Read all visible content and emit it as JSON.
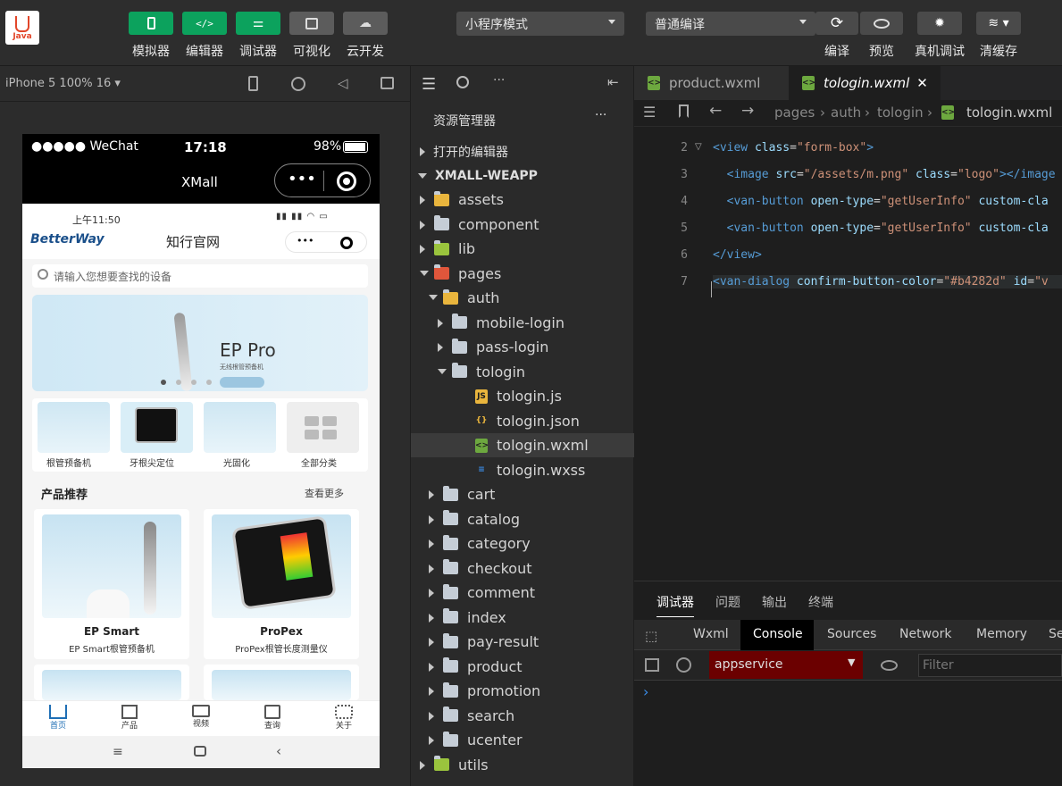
{
  "toolbar": {
    "logo_text": "Java",
    "buttons": [
      {
        "label": "模拟器",
        "icon": "phone-icon"
      },
      {
        "label": "编辑器",
        "icon": "code-icon"
      },
      {
        "label": "调试器",
        "icon": "sliders-icon"
      },
      {
        "label": "可视化",
        "icon": "layout-icon"
      },
      {
        "label": "云开发",
        "icon": "cloud-icon"
      }
    ],
    "mode_select": "小程序模式",
    "compile_select": "普通编译",
    "right_buttons": [
      {
        "label": "编译",
        "icon": "refresh-icon"
      },
      {
        "label": "预览",
        "icon": "eye-icon"
      },
      {
        "label": "真机调试",
        "icon": "bug-icon"
      },
      {
        "label": "清缓存",
        "icon": "layers-icon"
      }
    ]
  },
  "simulator": {
    "device_label": "iPhone 5 100% 16 ▾",
    "status": {
      "carrier": "●●●●● WeChat",
      "time": "17:18",
      "battery": "98%"
    },
    "nav_title": "XMall",
    "inner_status_time": "上午11:50",
    "brand_logo": "BetterWay",
    "site_title": "知行官网",
    "search_placeholder": "请输入您想要查找的设备",
    "banner_title": "EP Pro",
    "banner_sub": "无线根管预备机",
    "categories": [
      "根管预备机",
      "牙根尖定位",
      "光固化",
      "全部分类"
    ],
    "section_title": "产品推荐",
    "section_more": "查看更多",
    "products": [
      {
        "name": "EP Smart",
        "desc": "EP Smart根管预备机"
      },
      {
        "name": "ProPex",
        "desc": "ProPex根管长度测量仪"
      }
    ],
    "tabbar": [
      "首页",
      "产品",
      "视频",
      "查询",
      "关于"
    ]
  },
  "explorer": {
    "title": "资源管理器",
    "open_editors": "打开的编辑器",
    "project": "XMALL-WEAPP",
    "tree": [
      {
        "label": "assets",
        "depth": 1,
        "state": "collapsed",
        "type": "folder-special"
      },
      {
        "label": "component",
        "depth": 1,
        "state": "collapsed",
        "type": "folder"
      },
      {
        "label": "lib",
        "depth": 1,
        "state": "collapsed",
        "type": "folder-lib"
      },
      {
        "label": "pages",
        "depth": 1,
        "state": "expanded",
        "type": "folder-pages"
      },
      {
        "label": "auth",
        "depth": 2,
        "state": "expanded",
        "type": "folder-auth"
      },
      {
        "label": "mobile-login",
        "depth": 3,
        "state": "collapsed",
        "type": "folder"
      },
      {
        "label": "pass-login",
        "depth": 3,
        "state": "collapsed",
        "type": "folder"
      },
      {
        "label": "tologin",
        "depth": 3,
        "state": "expanded",
        "type": "folder-open"
      },
      {
        "label": "tologin.js",
        "depth": 4,
        "state": "file",
        "type": "js"
      },
      {
        "label": "tologin.json",
        "depth": 4,
        "state": "file",
        "type": "json"
      },
      {
        "label": "tologin.wxml",
        "depth": 4,
        "state": "file",
        "type": "wxml",
        "selected": true
      },
      {
        "label": "tologin.wxss",
        "depth": 4,
        "state": "file",
        "type": "wxss"
      },
      {
        "label": "cart",
        "depth": 2,
        "state": "collapsed",
        "type": "folder"
      },
      {
        "label": "catalog",
        "depth": 2,
        "state": "collapsed",
        "type": "folder"
      },
      {
        "label": "category",
        "depth": 2,
        "state": "collapsed",
        "type": "folder"
      },
      {
        "label": "checkout",
        "depth": 2,
        "state": "collapsed",
        "type": "folder"
      },
      {
        "label": "comment",
        "depth": 2,
        "state": "collapsed",
        "type": "folder"
      },
      {
        "label": "index",
        "depth": 2,
        "state": "collapsed",
        "type": "folder"
      },
      {
        "label": "pay-result",
        "depth": 2,
        "state": "collapsed",
        "type": "folder"
      },
      {
        "label": "product",
        "depth": 2,
        "state": "collapsed",
        "type": "folder"
      },
      {
        "label": "promotion",
        "depth": 2,
        "state": "collapsed",
        "type": "folder"
      },
      {
        "label": "search",
        "depth": 2,
        "state": "collapsed",
        "type": "folder"
      },
      {
        "label": "ucenter",
        "depth": 2,
        "state": "collapsed",
        "type": "folder"
      },
      {
        "label": "utils",
        "depth": 1,
        "state": "collapsed",
        "type": "folder-lib"
      }
    ]
  },
  "editor": {
    "tabs": [
      {
        "label": "product.wxml",
        "active": false
      },
      {
        "label": "tologin.wxml",
        "active": true
      }
    ],
    "breadcrumb": [
      "pages",
      "auth",
      "tologin",
      "tologin.wxml"
    ],
    "lines": [
      {
        "n": "2",
        "html": "<span class='tag'>&lt;view</span> <span class='attr'>class</span><span class='pun'>=</span><span class='str'>\"form-box\"</span><span class='tag'>&gt;</span>"
      },
      {
        "n": "3",
        "html": "  <span class='tag'>&lt;image</span> <span class='attr'>src</span><span class='pun'>=</span><span class='str'>\"/assets/m.png\"</span> <span class='attr'>class</span><span class='pun'>=</span><span class='str'>\"logo\"</span><span class='tag'>&gt;&lt;/image</span>"
      },
      {
        "n": "4",
        "html": "  <span class='tag'>&lt;van-button</span> <span class='attr'>open-type</span><span class='pun'>=</span><span class='str'>\"getUserInfo\"</span> <span class='attr'>custom-cla</span>"
      },
      {
        "n": "5",
        "html": "  <span class='tag'>&lt;van-button</span> <span class='attr'>open-type</span><span class='pun'>=</span><span class='str'>\"getUserInfo\"</span> <span class='attr'>custom-cla</span>"
      },
      {
        "n": "6",
        "html": "<span class='tag'>&lt;/view&gt;</span>"
      },
      {
        "n": "7",
        "html": "<span class='tag'>&lt;van-dialog</span> <span class='attr'>confirm-button-color</span><span class='pun'>=</span><span class='str'>\"#b4282d\"</span> <span class='attr'>id</span><span class='pun'>=</span><span class='str'>\"v</span>"
      }
    ]
  },
  "debugger": {
    "panel_tabs": [
      "调试器",
      "问题",
      "输出",
      "终端"
    ],
    "devtools_tabs": [
      "Wxml",
      "Console",
      "Sources",
      "Network",
      "Memory",
      "Se"
    ],
    "context_select": "appservice",
    "filter_placeholder": "Filter",
    "prompt": "›"
  },
  "colors": {
    "accent_green": "#0ca25d",
    "brand_red": "#b4282d"
  }
}
